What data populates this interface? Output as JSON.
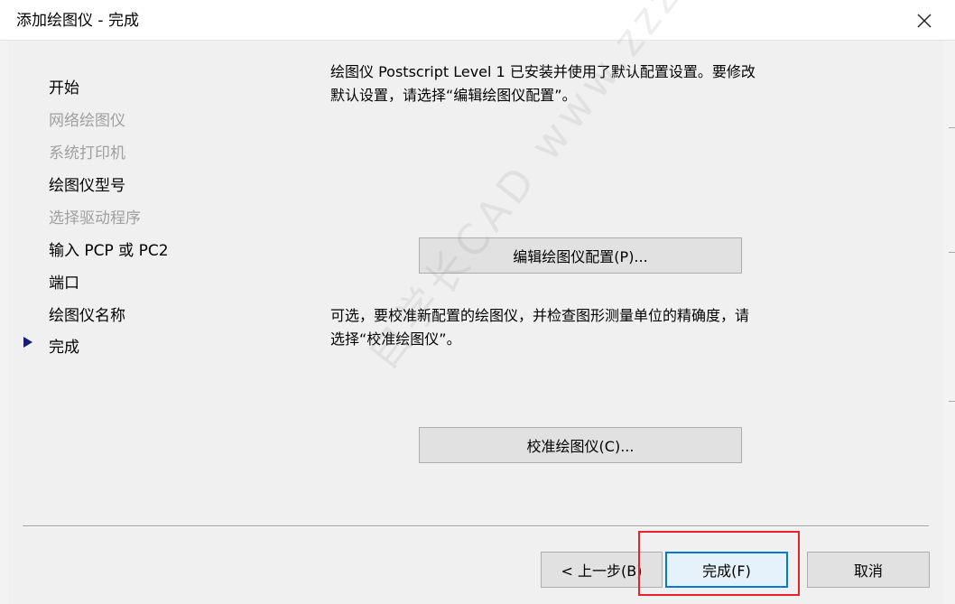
{
  "window": {
    "title": "添加绘图仪 - 完成",
    "close_glyph": "✕"
  },
  "steps": [
    {
      "label": "开始",
      "enabled": true
    },
    {
      "label": "网络绘图仪",
      "enabled": false
    },
    {
      "label": "系统打印机",
      "enabled": false
    },
    {
      "label": "绘图仪型号",
      "enabled": true
    },
    {
      "label": "选择驱动程序",
      "enabled": false
    },
    {
      "label": "输入 PCP 或 PC2",
      "enabled": true
    },
    {
      "label": "端口",
      "enabled": true
    },
    {
      "label": "绘图仪名称",
      "enabled": true
    },
    {
      "label": "完成",
      "enabled": true,
      "current": true
    }
  ],
  "content": {
    "desc1_line1": "绘图仪 Postscript Level 1 已安装并使用了默认配置设置。要修改",
    "desc1_line2": "默认设置，请选择“编辑绘图仪配置”。",
    "edit_button": "编辑绘图仪配置(P)...",
    "desc2_line1": "可选，要校准新配置的绘图仪，并检查图形测量单位的精确度，请",
    "desc2_line2": "选择“校准绘图仪”。",
    "calibrate_button": "校准绘图仪(C)..."
  },
  "footer": {
    "back_button": "< 上一步(B)",
    "finish_button": "完成(F)",
    "cancel_button": "取消"
  },
  "watermark": "自学长CAD www.zzzcad.com",
  "colors": {
    "highlight": "#e8212b",
    "focus": "#0078d7",
    "current_arrow": "#1a1a7a"
  }
}
